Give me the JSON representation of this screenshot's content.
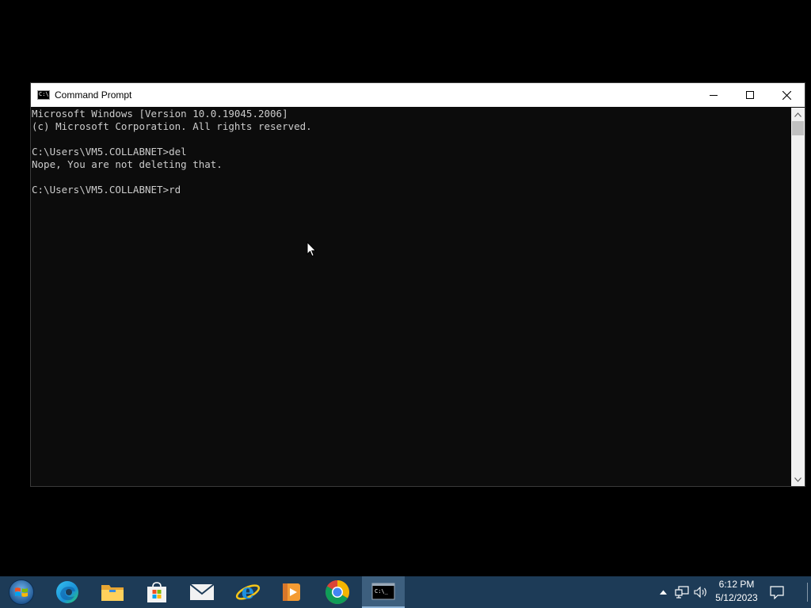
{
  "window": {
    "title": "Command Prompt",
    "console_lines": [
      "Microsoft Windows [Version 10.0.19045.2006]",
      "(c) Microsoft Corporation. All rights reserved.",
      "",
      "C:\\Users\\VM5.COLLABNET>del",
      "Nope, You are not deleting that.",
      "",
      "C:\\Users\\VM5.COLLABNET>rd"
    ],
    "controls": [
      "minimize-icon",
      "maximize-icon",
      "close-icon"
    ]
  },
  "taskbar": {
    "apps": [
      {
        "name": "start-button",
        "icon": "windows-logo-icon"
      },
      {
        "name": "edge",
        "icon": "edge-icon"
      },
      {
        "name": "file-explorer",
        "icon": "folder-icon"
      },
      {
        "name": "microsoft-store",
        "icon": "store-bag-icon"
      },
      {
        "name": "mail",
        "icon": "mail-icon"
      },
      {
        "name": "internet-explorer",
        "icon": "ie-icon"
      },
      {
        "name": "media-player",
        "icon": "media-player-icon"
      },
      {
        "name": "chrome",
        "icon": "chrome-icon"
      },
      {
        "name": "command-prompt",
        "icon": "cmd-icon",
        "active": true
      }
    ],
    "tray": {
      "time": "6:12 PM",
      "date": "5/12/2023",
      "icons": [
        "chevron-up-icon",
        "network-icon",
        "volume-icon",
        "notification-icon"
      ]
    }
  },
  "colors": {
    "taskbar": "#1d3b57",
    "console_bg": "#0c0c0c",
    "console_text": "#cccccc",
    "titlebar": "#ffffff"
  }
}
